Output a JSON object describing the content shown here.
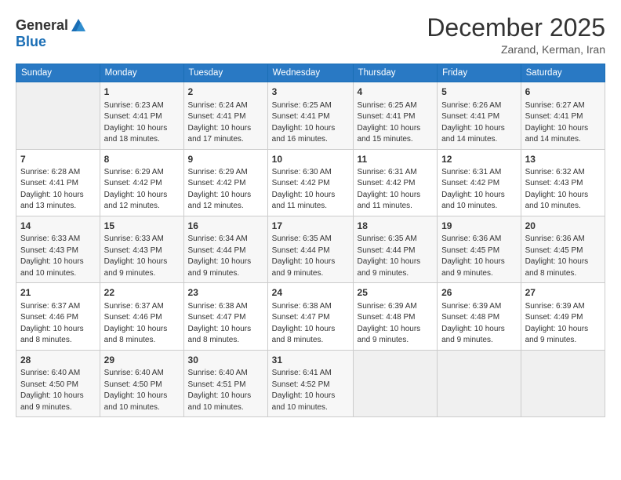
{
  "logo": {
    "general": "General",
    "blue": "Blue"
  },
  "title": "December 2025",
  "subtitle": "Zarand, Kerman, Iran",
  "headers": [
    "Sunday",
    "Monday",
    "Tuesday",
    "Wednesday",
    "Thursday",
    "Friday",
    "Saturday"
  ],
  "rows": [
    [
      {
        "day": "",
        "info": ""
      },
      {
        "day": "1",
        "info": "Sunrise: 6:23 AM\nSunset: 4:41 PM\nDaylight: 10 hours\nand 18 minutes."
      },
      {
        "day": "2",
        "info": "Sunrise: 6:24 AM\nSunset: 4:41 PM\nDaylight: 10 hours\nand 17 minutes."
      },
      {
        "day": "3",
        "info": "Sunrise: 6:25 AM\nSunset: 4:41 PM\nDaylight: 10 hours\nand 16 minutes."
      },
      {
        "day": "4",
        "info": "Sunrise: 6:25 AM\nSunset: 4:41 PM\nDaylight: 10 hours\nand 15 minutes."
      },
      {
        "day": "5",
        "info": "Sunrise: 6:26 AM\nSunset: 4:41 PM\nDaylight: 10 hours\nand 14 minutes."
      },
      {
        "day": "6",
        "info": "Sunrise: 6:27 AM\nSunset: 4:41 PM\nDaylight: 10 hours\nand 14 minutes."
      }
    ],
    [
      {
        "day": "7",
        "info": "Sunrise: 6:28 AM\nSunset: 4:41 PM\nDaylight: 10 hours\nand 13 minutes."
      },
      {
        "day": "8",
        "info": "Sunrise: 6:29 AM\nSunset: 4:42 PM\nDaylight: 10 hours\nand 12 minutes."
      },
      {
        "day": "9",
        "info": "Sunrise: 6:29 AM\nSunset: 4:42 PM\nDaylight: 10 hours\nand 12 minutes."
      },
      {
        "day": "10",
        "info": "Sunrise: 6:30 AM\nSunset: 4:42 PM\nDaylight: 10 hours\nand 11 minutes."
      },
      {
        "day": "11",
        "info": "Sunrise: 6:31 AM\nSunset: 4:42 PM\nDaylight: 10 hours\nand 11 minutes."
      },
      {
        "day": "12",
        "info": "Sunrise: 6:31 AM\nSunset: 4:42 PM\nDaylight: 10 hours\nand 10 minutes."
      },
      {
        "day": "13",
        "info": "Sunrise: 6:32 AM\nSunset: 4:43 PM\nDaylight: 10 hours\nand 10 minutes."
      }
    ],
    [
      {
        "day": "14",
        "info": "Sunrise: 6:33 AM\nSunset: 4:43 PM\nDaylight: 10 hours\nand 10 minutes."
      },
      {
        "day": "15",
        "info": "Sunrise: 6:33 AM\nSunset: 4:43 PM\nDaylight: 10 hours\nand 9 minutes."
      },
      {
        "day": "16",
        "info": "Sunrise: 6:34 AM\nSunset: 4:44 PM\nDaylight: 10 hours\nand 9 minutes."
      },
      {
        "day": "17",
        "info": "Sunrise: 6:35 AM\nSunset: 4:44 PM\nDaylight: 10 hours\nand 9 minutes."
      },
      {
        "day": "18",
        "info": "Sunrise: 6:35 AM\nSunset: 4:44 PM\nDaylight: 10 hours\nand 9 minutes."
      },
      {
        "day": "19",
        "info": "Sunrise: 6:36 AM\nSunset: 4:45 PM\nDaylight: 10 hours\nand 9 minutes."
      },
      {
        "day": "20",
        "info": "Sunrise: 6:36 AM\nSunset: 4:45 PM\nDaylight: 10 hours\nand 8 minutes."
      }
    ],
    [
      {
        "day": "21",
        "info": "Sunrise: 6:37 AM\nSunset: 4:46 PM\nDaylight: 10 hours\nand 8 minutes."
      },
      {
        "day": "22",
        "info": "Sunrise: 6:37 AM\nSunset: 4:46 PM\nDaylight: 10 hours\nand 8 minutes."
      },
      {
        "day": "23",
        "info": "Sunrise: 6:38 AM\nSunset: 4:47 PM\nDaylight: 10 hours\nand 8 minutes."
      },
      {
        "day": "24",
        "info": "Sunrise: 6:38 AM\nSunset: 4:47 PM\nDaylight: 10 hours\nand 8 minutes."
      },
      {
        "day": "25",
        "info": "Sunrise: 6:39 AM\nSunset: 4:48 PM\nDaylight: 10 hours\nand 9 minutes."
      },
      {
        "day": "26",
        "info": "Sunrise: 6:39 AM\nSunset: 4:48 PM\nDaylight: 10 hours\nand 9 minutes."
      },
      {
        "day": "27",
        "info": "Sunrise: 6:39 AM\nSunset: 4:49 PM\nDaylight: 10 hours\nand 9 minutes."
      }
    ],
    [
      {
        "day": "28",
        "info": "Sunrise: 6:40 AM\nSunset: 4:50 PM\nDaylight: 10 hours\nand 9 minutes."
      },
      {
        "day": "29",
        "info": "Sunrise: 6:40 AM\nSunset: 4:50 PM\nDaylight: 10 hours\nand 10 minutes."
      },
      {
        "day": "30",
        "info": "Sunrise: 6:40 AM\nSunset: 4:51 PM\nDaylight: 10 hours\nand 10 minutes."
      },
      {
        "day": "31",
        "info": "Sunrise: 6:41 AM\nSunset: 4:52 PM\nDaylight: 10 hours\nand 10 minutes."
      },
      {
        "day": "",
        "info": ""
      },
      {
        "day": "",
        "info": ""
      },
      {
        "day": "",
        "info": ""
      }
    ]
  ]
}
